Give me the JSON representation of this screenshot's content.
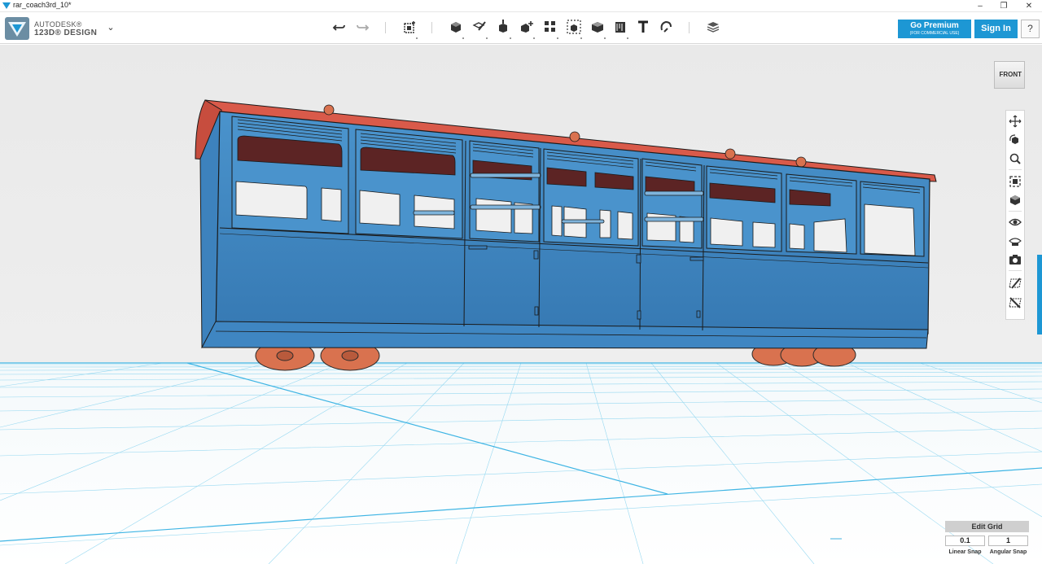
{
  "window": {
    "title": "rar_coach3rd_10*",
    "controls": [
      "minimize",
      "restore",
      "close"
    ]
  },
  "brand": {
    "line1": "AUTODESK®",
    "line2": "123D® DESIGN",
    "menu_icon": "chevron-down-icon"
  },
  "toolbar": {
    "tools": [
      {
        "id": "undo",
        "icon": "undo-icon"
      },
      {
        "id": "redo",
        "icon": "redo-icon"
      },
      {
        "id": "transform",
        "icon": "transform-icon"
      },
      {
        "id": "primitives",
        "icon": "cube-primitive-icon"
      },
      {
        "id": "sketch",
        "icon": "sketch-icon"
      },
      {
        "id": "construct",
        "icon": "construct-icon"
      },
      {
        "id": "modify",
        "icon": "modify-icon"
      },
      {
        "id": "pattern",
        "icon": "pattern-icon"
      },
      {
        "id": "grouping",
        "icon": "group-icon"
      },
      {
        "id": "combine",
        "icon": "combine-icon"
      },
      {
        "id": "measure",
        "icon": "measure-icon"
      },
      {
        "id": "text",
        "icon": "text-icon"
      },
      {
        "id": "snap",
        "icon": "snap-icon"
      },
      {
        "id": "materials",
        "icon": "layers-icon"
      }
    ],
    "premium_label": "Go Premium",
    "premium_sublabel": "(FOR COMMERCIAL USE)",
    "signin_label": "Sign In",
    "help_label": "?"
  },
  "viewcube": {
    "face_label": "FRONT"
  },
  "navbar": {
    "buttons": [
      "pan-icon",
      "orbit-icon",
      "zoom-icon",
      "fit-icon",
      "view-icon",
      "visibility-icon",
      "materials-view-icon",
      "screenshot-icon",
      "snap-grid-icon",
      "hide-grid-icon"
    ]
  },
  "grid_panel": {
    "edit_grid_label": "Edit Grid",
    "linear_snap_value": "0.1",
    "angular_snap_value": "1",
    "linear_snap_label": "Linear Snap",
    "angular_snap_label": "Angular Snap"
  },
  "colors": {
    "accent": "#1d97d4",
    "model_body": "#3f8ac4",
    "model_roof": "#d95a4a",
    "wheels": "#d9724f",
    "grid_line": "#55c0e8"
  }
}
